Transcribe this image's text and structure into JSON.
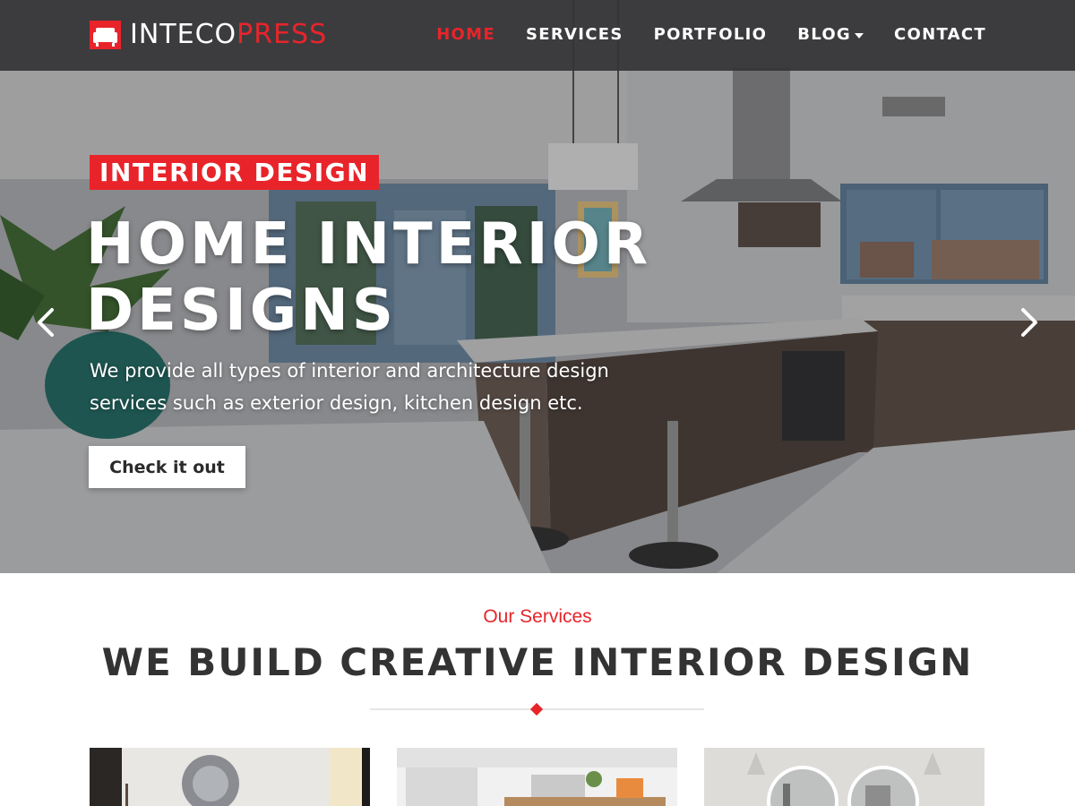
{
  "brand": {
    "logo_part1": "INTECO",
    "logo_part2": "PRESS",
    "accent_color": "#e8242a"
  },
  "nav": {
    "items": [
      {
        "label": "HOME",
        "active": true
      },
      {
        "label": "SERVICES",
        "active": false
      },
      {
        "label": "PORTFOLIO",
        "active": false
      },
      {
        "label": "BLOG",
        "active": false,
        "has_dropdown": true
      },
      {
        "label": "CONTACT",
        "active": false
      }
    ]
  },
  "hero": {
    "badge": "INTERIOR DESIGN",
    "title_line1": "HOME INTERIOR",
    "title_line2": "DESIGNS",
    "description": "We provide all types of interior and architecture design services such as exterior design, kitchen design etc.",
    "button_label": "Check it out",
    "prev_icon": "chevron-left-icon",
    "next_icon": "chevron-right-icon"
  },
  "services": {
    "subtitle": "Our Services",
    "title": "WE BUILD CREATIVE INTERIOR DESIGN",
    "cards": [
      {
        "image": "living-room-photo"
      },
      {
        "image": "office-desk-photo"
      },
      {
        "image": "bathroom-mirror-photo"
      }
    ]
  }
}
